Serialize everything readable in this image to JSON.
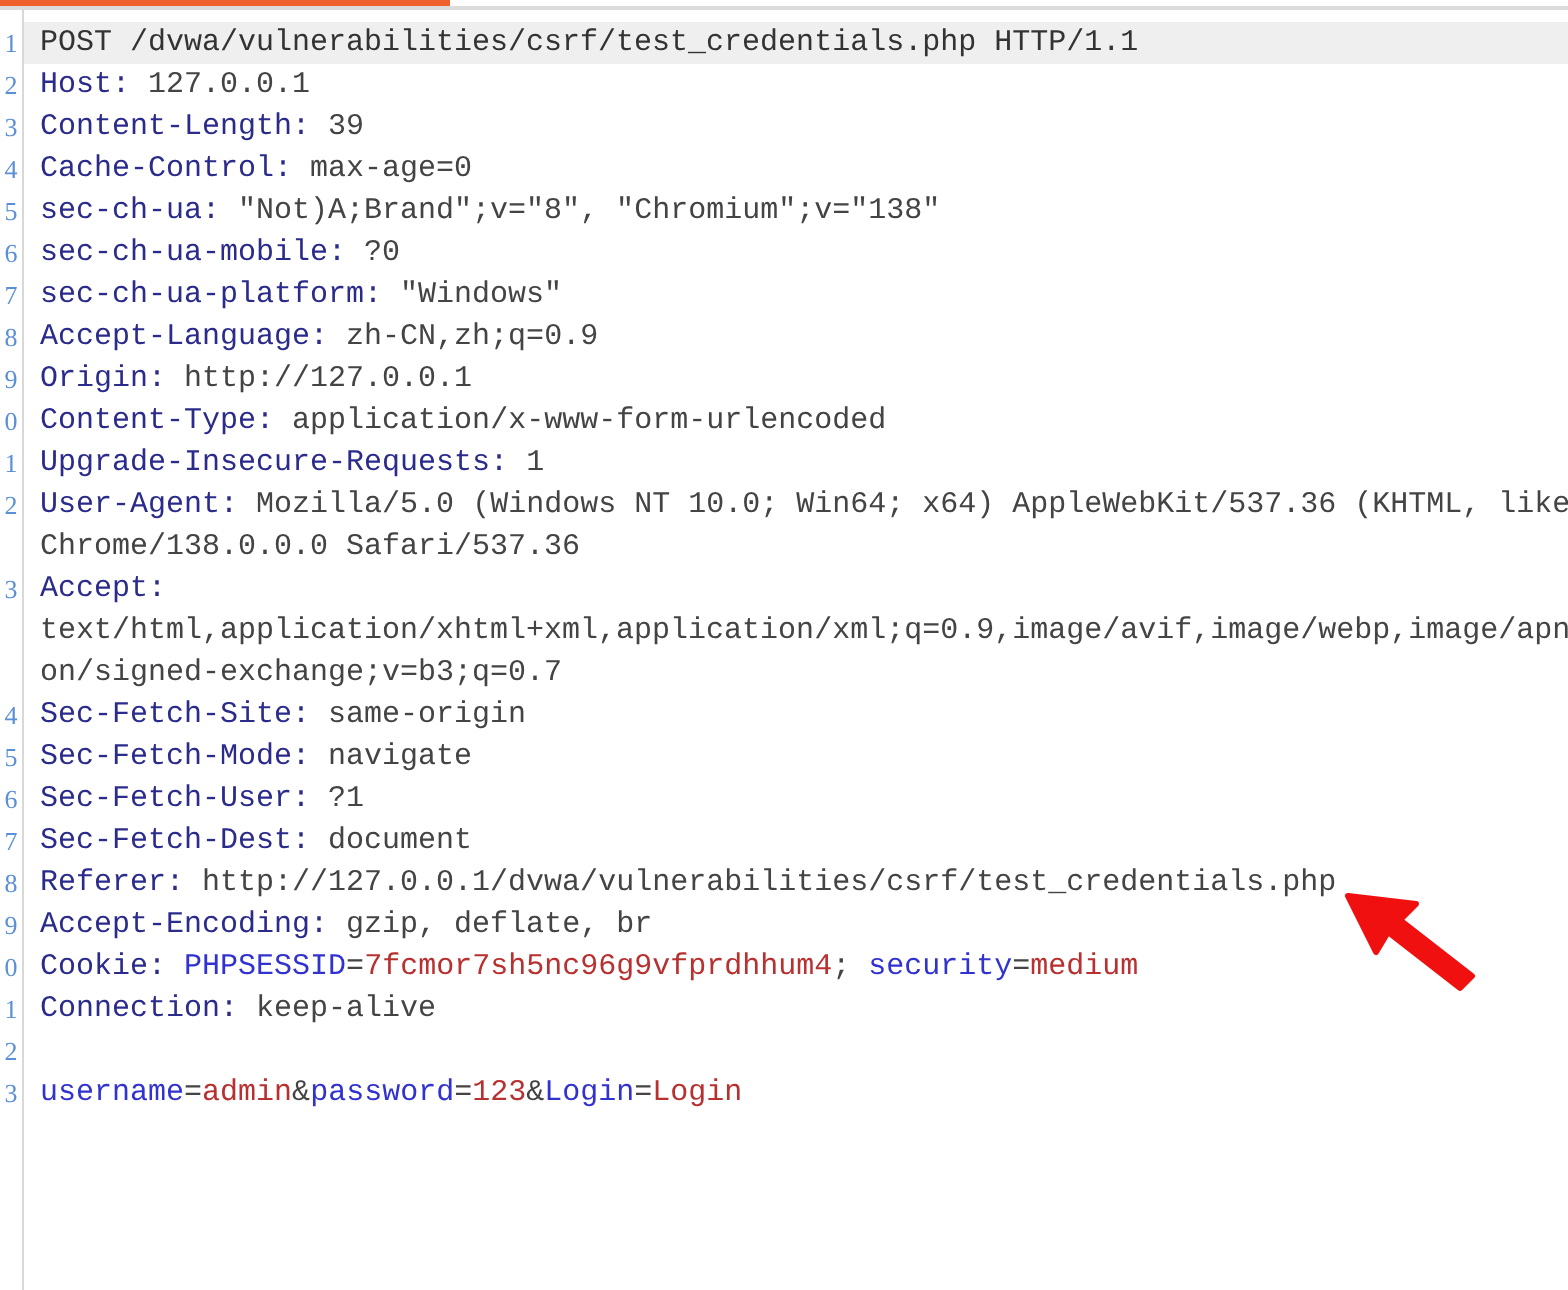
{
  "lines": [
    {
      "number": "1",
      "kind": "request",
      "text": "POST /dvwa/vulnerabilities/csrf/test_credentials.php HTTP/1.1",
      "selected": true
    },
    {
      "number": "2",
      "kind": "header",
      "name": "Host:",
      "value": "127.0.0.1",
      "selected": false
    },
    {
      "number": "3",
      "kind": "header",
      "name": "Content-Length:",
      "value": "39",
      "selected": false
    },
    {
      "number": "4",
      "kind": "header",
      "name": "Cache-Control:",
      "value": "max-age=0",
      "selected": false
    },
    {
      "number": "5",
      "kind": "header",
      "name": "sec-ch-ua:",
      "value": "\"Not)A;Brand\";v=\"8\", \"Chromium\";v=\"138\"",
      "selected": false
    },
    {
      "number": "6",
      "kind": "header",
      "name": "sec-ch-ua-mobile:",
      "value": "?0",
      "selected": false
    },
    {
      "number": "7",
      "kind": "header",
      "name": "sec-ch-ua-platform:",
      "value": "\"Windows\"",
      "selected": false
    },
    {
      "number": "8",
      "kind": "header",
      "name": "Accept-Language:",
      "value": "zh-CN,zh;q=0.9",
      "selected": false
    },
    {
      "number": "9",
      "kind": "header",
      "name": "Origin:",
      "value": "http://127.0.0.1",
      "selected": false
    },
    {
      "number": "0",
      "kind": "header",
      "name": "Content-Type:",
      "value": "application/x-www-form-urlencoded",
      "selected": false
    },
    {
      "number": "1",
      "kind": "header",
      "name": "Upgrade-Insecure-Requests:",
      "value": "1",
      "selected": false
    },
    {
      "number": "2",
      "kind": "header",
      "name": "User-Agent:",
      "value": "Mozilla/5.0 (Windows NT 10.0; Win64; x64) AppleWebKit/537.36 (KHTML, like",
      "continuation": [
        "Chrome/138.0.0.0 Safari/537.36"
      ],
      "selected": false
    },
    {
      "number": "3",
      "kind": "header",
      "name": "Accept:",
      "continuation": [
        "text/html,application/xhtml+xml,application/xml;q=0.9,image/avif,image/webp,image/apn",
        "on/signed-exchange;v=b3;q=0.7"
      ],
      "selected": false
    },
    {
      "number": "4",
      "kind": "header",
      "name": "Sec-Fetch-Site:",
      "value": "same-origin",
      "selected": false
    },
    {
      "number": "5",
      "kind": "header",
      "name": "Sec-Fetch-Mode:",
      "value": "navigate",
      "selected": false
    },
    {
      "number": "6",
      "kind": "header",
      "name": "Sec-Fetch-User:",
      "value": "?1",
      "selected": false
    },
    {
      "number": "7",
      "kind": "header",
      "name": "Sec-Fetch-Dest:",
      "value": "document",
      "selected": false
    },
    {
      "number": "8",
      "kind": "header",
      "name": "Referer:",
      "value": "http://127.0.0.1/dvwa/vulnerabilities/csrf/test_credentials.php",
      "selected": false
    },
    {
      "number": "9",
      "kind": "header",
      "name": "Accept-Encoding:",
      "value": "gzip, deflate, br",
      "selected": false
    },
    {
      "number": "0",
      "kind": "cookie",
      "name": "Cookie:",
      "separator": ";",
      "assign": "=",
      "pairs": [
        {
          "key": "PHPSESSID",
          "value": "7fcmor7sh5nc96g9vfprdhhum4"
        },
        {
          "key": "security",
          "value": "medium"
        }
      ],
      "selected": false
    },
    {
      "number": "1",
      "kind": "header",
      "name": "Connection:",
      "value": "keep-alive",
      "selected": false
    },
    {
      "number": "2",
      "kind": "blank",
      "selected": false
    },
    {
      "number": "3",
      "kind": "body",
      "separator": "&",
      "assign": "=",
      "pairs": [
        {
          "key": "username",
          "value": "admin"
        },
        {
          "key": "password",
          "value": "123"
        },
        {
          "key": "Login",
          "value": "Login"
        }
      ],
      "selected": false
    }
  ]
}
